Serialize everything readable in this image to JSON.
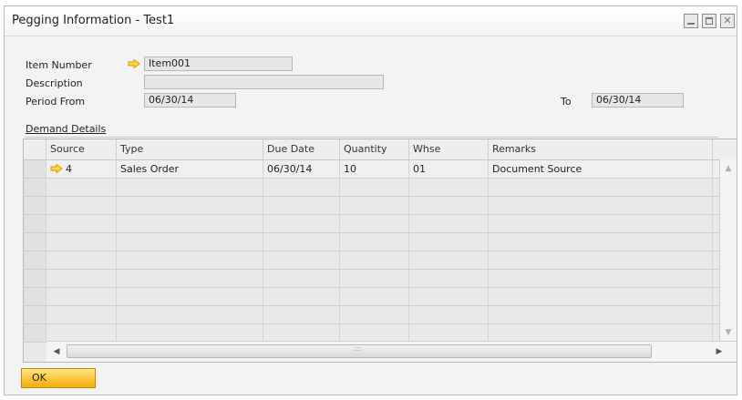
{
  "window": {
    "title": "Pegging Information - Test1"
  },
  "header": {
    "item_number_label": "Item Number",
    "item_number_value": "Item001",
    "description_label": "Description",
    "description_value": "",
    "period_from_label": "Period From",
    "period_from_value": "06/30/14",
    "to_label": "To",
    "to_value": "06/30/14"
  },
  "demand_details": {
    "section_label": "Demand Details",
    "columns": [
      "Source",
      "Type",
      "Due Date",
      "Quantity",
      "Whse",
      "Remarks"
    ],
    "rows": [
      {
        "source": "4",
        "type": "Sales Order",
        "due_date": "06/30/14",
        "quantity": "10",
        "whse": "01",
        "remarks": "Document Source"
      }
    ],
    "empty_rows": 9
  },
  "footer": {
    "ok_label": "OK"
  },
  "colors": {
    "link_arrow": "#f0b400",
    "ok_button": "#fcc538"
  },
  "icons": [
    "link-arrow-icon",
    "minimize-icon",
    "maximize-icon",
    "close-icon",
    "scroll-up-icon",
    "scroll-down-icon",
    "scroll-left-icon",
    "scroll-right-icon"
  ]
}
